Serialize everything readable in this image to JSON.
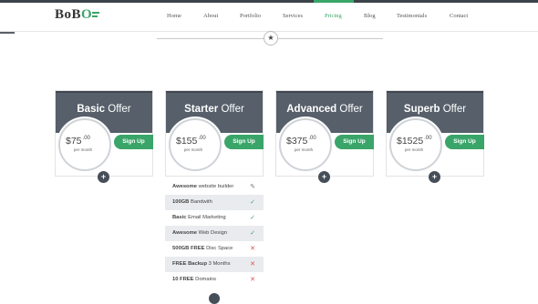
{
  "logo": {
    "text_start": "BoB",
    "text_o": "O"
  },
  "nav": [
    {
      "label": "Home",
      "active": false
    },
    {
      "label": "About",
      "active": false
    },
    {
      "label": "Portfolio",
      "active": false
    },
    {
      "label": "Services",
      "active": false
    },
    {
      "label": "Pricing",
      "active": true
    },
    {
      "label": "Blog",
      "active": false
    },
    {
      "label": "Testimonials",
      "active": false
    },
    {
      "label": "Contact",
      "active": false
    }
  ],
  "divider": {
    "icon": "star-icon",
    "glyph": "★"
  },
  "plans": [
    {
      "title_bold": "Basic",
      "title_rest": " Offer",
      "price": "$75",
      "cents": ".00",
      "period": "per month",
      "signup": "Sign Up"
    },
    {
      "title_bold": "Starter",
      "title_rest": " Offer",
      "price": "$155",
      "cents": ".00",
      "period": "per month",
      "signup": "Sign Up"
    },
    {
      "title_bold": "Advanced",
      "title_rest": " Offer",
      "price": "$375",
      "cents": ".00",
      "period": "per month",
      "signup": "Sign Up"
    },
    {
      "title_bold": "Superb",
      "title_rest": " Offer",
      "price": "$1525",
      "cents": ".00",
      "period": "per month",
      "signup": "Sign Up"
    }
  ],
  "expand_glyph": "+",
  "features": [
    {
      "bold": "Awesome",
      "rest": " website builder",
      "icon": "pencil-icon",
      "glyph": "✎"
    },
    {
      "bold": "100GB",
      "rest": " Bandwith",
      "icon": "check-icon",
      "glyph": "✓"
    },
    {
      "bold": "Basic",
      "rest": " Email Marketing",
      "icon": "check-icon",
      "glyph": "✓"
    },
    {
      "bold": "Awesome",
      "rest": " Web Design",
      "icon": "check-icon",
      "glyph": "✓"
    },
    {
      "bold": "500GB FREE",
      "rest": " Disc Space",
      "icon": "cross-icon",
      "glyph": "✕"
    },
    {
      "bold": "FREE Backup",
      "rest": " 3 Months",
      "icon": "cross-icon",
      "glyph": "✕"
    },
    {
      "bold": "10 FREE",
      "rest": " Domains",
      "icon": "cross-icon",
      "glyph": "✕"
    }
  ],
  "colors": {
    "accent": "#3aa568",
    "header": "#565f6a",
    "cross": "#e04f4f"
  }
}
